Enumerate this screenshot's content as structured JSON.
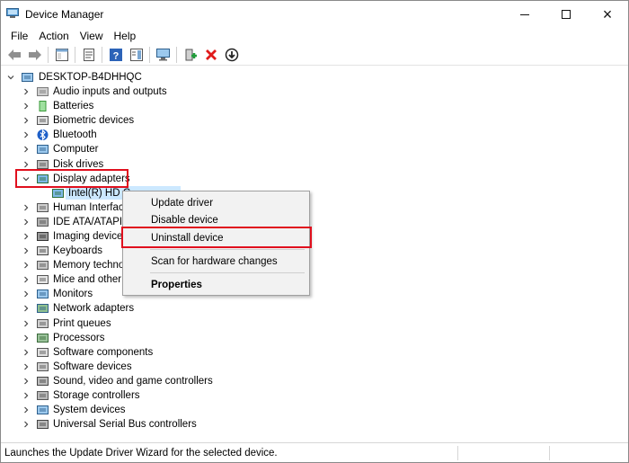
{
  "window": {
    "title": "Device Manager",
    "icon": "device-manager-icon",
    "controls": {
      "minimize": "minimize-icon",
      "maximize": "maximize-icon",
      "close": "×"
    }
  },
  "menu": [
    "File",
    "Action",
    "View",
    "Help"
  ],
  "toolbar": [
    "back-arrow-icon",
    "forward-arrow-icon",
    "properties-panel-icon",
    "show-hide-tree-icon",
    "help-icon",
    "action-pane-icon",
    "monitor-scan-icon",
    "add-driver-icon",
    "uninstall-x-icon",
    "update-driver-down-icon"
  ],
  "tree": {
    "root": "DESKTOP-B4DHHQC",
    "categories": [
      {
        "label": "Audio inputs and outputs",
        "icon": "speaker-icon",
        "expanded": false
      },
      {
        "label": "Batteries",
        "icon": "battery-icon",
        "expanded": false
      },
      {
        "label": "Biometric devices",
        "icon": "fingerprint-icon",
        "expanded": false
      },
      {
        "label": "Bluetooth",
        "icon": "bluetooth-icon",
        "expanded": false
      },
      {
        "label": "Computer",
        "icon": "computer-icon",
        "expanded": false
      },
      {
        "label": "Disk drives",
        "icon": "disk-drive-icon",
        "expanded": false
      },
      {
        "label": "Display adapters",
        "icon": "display-adapter-icon",
        "expanded": true
      },
      {
        "label": "Human Interface",
        "icon": "hid-icon",
        "expanded": false
      },
      {
        "label": "IDE ATA/ATAPI c",
        "icon": "ide-controller-icon",
        "expanded": false
      },
      {
        "label": "Imaging devices",
        "icon": "camera-icon",
        "expanded": false
      },
      {
        "label": "Keyboards",
        "icon": "keyboard-icon",
        "expanded": false
      },
      {
        "label": "Memory techno",
        "icon": "memory-icon",
        "expanded": false
      },
      {
        "label": "Mice and other p",
        "icon": "mouse-icon",
        "expanded": false
      },
      {
        "label": "Monitors",
        "icon": "monitor-icon",
        "expanded": false
      },
      {
        "label": "Network adapters",
        "icon": "network-adapter-icon",
        "expanded": false
      },
      {
        "label": "Print queues",
        "icon": "printer-icon",
        "expanded": false
      },
      {
        "label": "Processors",
        "icon": "processor-icon",
        "expanded": false
      },
      {
        "label": "Software components",
        "icon": "software-component-icon",
        "expanded": false
      },
      {
        "label": "Software devices",
        "icon": "software-device-icon",
        "expanded": false
      },
      {
        "label": "Sound, video and game controllers",
        "icon": "sound-icon",
        "expanded": false
      },
      {
        "label": "Storage controllers",
        "icon": "storage-controller-icon",
        "expanded": false
      },
      {
        "label": "System devices",
        "icon": "system-device-icon",
        "expanded": false
      },
      {
        "label": "Universal Serial Bus controllers",
        "icon": "usb-icon",
        "expanded": false
      }
    ],
    "display_child": "Intel(R) HD G"
  },
  "context_menu": {
    "items": [
      "Update driver",
      "Disable device",
      "Uninstall device",
      "Scan for hardware changes",
      "Properties"
    ]
  },
  "status": "Launches the Update Driver Wizard for the selected device."
}
